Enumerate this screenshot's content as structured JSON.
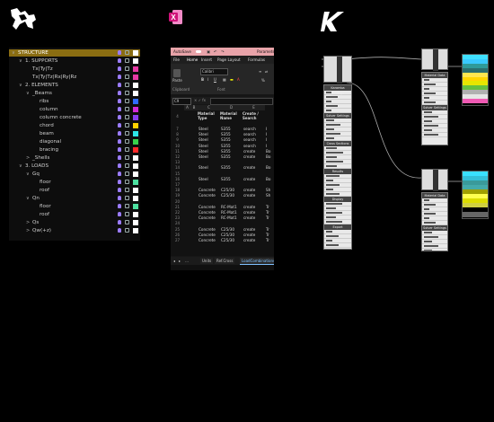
{
  "apps": {
    "rhino_logo": "rhino-icon",
    "excel_logo": "excel-icon",
    "gh_logo": "grasshopper-icon"
  },
  "layers": [
    {
      "label": "STRUCTURE",
      "indent": 0,
      "twisty": "∨",
      "selected": true,
      "color": "#ffffff"
    },
    {
      "label": "1. SUPPORTS",
      "indent": 1,
      "twisty": "∨",
      "color": "#ffffff"
    },
    {
      "label": "Tx|Ty|Tz",
      "indent": 2,
      "twisty": "",
      "color": "#e83aa5"
    },
    {
      "label": "Tx|Ty|Tz|Rx|Ry|Rz",
      "indent": 2,
      "twisty": "",
      "color": "#e83aa5"
    },
    {
      "label": "2. ELEMENTS",
      "indent": 1,
      "twisty": "∨",
      "color": "#ffffff"
    },
    {
      "label": "_Beams",
      "indent": 2,
      "twisty": "∨",
      "color": "#ffffff"
    },
    {
      "label": "ribs",
      "indent": 3,
      "twisty": "",
      "color": "#2f6bff"
    },
    {
      "label": "column",
      "indent": 3,
      "twisty": "",
      "color": "#d22ad6"
    },
    {
      "label": "column concrete",
      "indent": 3,
      "twisty": "",
      "color": "#8a3df0"
    },
    {
      "label": "chord",
      "indent": 3,
      "twisty": "",
      "color": "#ffd200"
    },
    {
      "label": "beam",
      "indent": 3,
      "twisty": "",
      "color": "#2ee6e6"
    },
    {
      "label": "diagonal",
      "indent": 3,
      "twisty": "",
      "color": "#37d14b"
    },
    {
      "label": "bracing",
      "indent": 3,
      "twisty": "",
      "color": "#ff2a2a"
    },
    {
      "label": "_Shells",
      "indent": 2,
      "twisty": ">",
      "color": "#ffffff"
    },
    {
      "label": "3. LOADS",
      "indent": 1,
      "twisty": "∨",
      "color": "#ffffff"
    },
    {
      "label": "Gq",
      "indent": 2,
      "twisty": "∨",
      "color": "#ffffff"
    },
    {
      "label": "floor",
      "indent": 3,
      "twisty": "",
      "color": "#4de0a0"
    },
    {
      "label": "roof",
      "indent": 3,
      "twisty": "",
      "color": "#ffffff"
    },
    {
      "label": "Qn",
      "indent": 2,
      "twisty": "∨",
      "color": "#ffffff"
    },
    {
      "label": "floor",
      "indent": 3,
      "twisty": "",
      "color": "#4de0a0"
    },
    {
      "label": "roof",
      "indent": 3,
      "twisty": "",
      "color": "#ffffff"
    },
    {
      "label": "Qs",
      "indent": 2,
      "twisty": ">",
      "color": "#ffffff"
    },
    {
      "label": "Qw(+z)",
      "indent": 2,
      "twisty": ">",
      "color": "#ffffff"
    }
  ],
  "excel": {
    "title_left": "AutoSave",
    "title_right": "Parameter",
    "menu": [
      "File",
      "Home",
      "Insert",
      "Page Layout",
      "Formulas"
    ],
    "ribbon": {
      "paste": "Paste",
      "clipboard": "Clipboard",
      "font_name": "Calibri",
      "font_label": "Font"
    },
    "name_box": "C9",
    "columns": [
      "A",
      "B",
      "C",
      "D",
      "E"
    ],
    "headers": {
      "c": "Material Type",
      "d": "Material Name",
      "e": "Create / Search"
    },
    "rows": [
      {
        "n": "7",
        "c": "Steel",
        "d": "S355",
        "e": "search",
        "f": "I"
      },
      {
        "n": "8",
        "c": "Steel",
        "d": "S355",
        "e": "search",
        "f": "I"
      },
      {
        "n": "9",
        "c": "Steel",
        "d": "S355",
        "e": "search",
        "f": "I"
      },
      {
        "n": "10",
        "c": "Steel",
        "d": "S355",
        "e": "search",
        "f": "I"
      },
      {
        "n": "11",
        "c": "Steel",
        "d": "S355",
        "e": "create",
        "f": "Bo"
      },
      {
        "n": "12",
        "c": "Steel",
        "d": "S355",
        "e": "create",
        "f": "Bo"
      },
      {
        "n": "13",
        "c": "",
        "d": "",
        "e": "",
        "f": ""
      },
      {
        "n": "14",
        "c": "Steel",
        "d": "S355",
        "e": "create",
        "f": "Bo"
      },
      {
        "n": "15",
        "c": "",
        "d": "",
        "e": "",
        "f": ""
      },
      {
        "n": "16",
        "c": "Steel",
        "d": "S355",
        "e": "create",
        "f": "Bo"
      },
      {
        "n": "17",
        "c": "",
        "d": "",
        "e": "",
        "f": ""
      },
      {
        "n": "18",
        "c": "Concrete",
        "d": "C25/30",
        "e": "create",
        "f": "Sh"
      },
      {
        "n": "19",
        "c": "Concrete",
        "d": "C25/30",
        "e": "create",
        "f": "Sh"
      },
      {
        "n": "20",
        "c": "",
        "d": "",
        "e": "",
        "f": ""
      },
      {
        "n": "21",
        "c": "Concrete",
        "d": "RC-Mat1",
        "e": "create",
        "f": "Tr"
      },
      {
        "n": "22",
        "c": "Concrete",
        "d": "RC-Mat1",
        "e": "create",
        "f": "Tr"
      },
      {
        "n": "23",
        "c": "Concrete",
        "d": "RC-Mat1",
        "e": "create",
        "f": "Tr"
      },
      {
        "n": "24",
        "c": "",
        "d": "",
        "e": "",
        "f": ""
      },
      {
        "n": "25",
        "c": "Concrete",
        "d": "C25/30",
        "e": "create",
        "f": "Tr"
      },
      {
        "n": "26",
        "c": "Concrete",
        "d": "C25/30",
        "e": "create",
        "f": "Tr"
      },
      {
        "n": "27",
        "c": "Concrete",
        "d": "C25/30",
        "e": "create",
        "f": "Tr"
      }
    ],
    "tabs": [
      "Units",
      "Ref.Cross",
      "LoadCombinations"
    ],
    "active_tab": 2
  },
  "gh": {
    "sections_mid": [
      "Karamba Settings",
      "Solver Settings",
      "Cross Sections",
      "Results",
      "Display",
      "Export",
      "Project Data"
    ],
    "sections_right": [
      "Material Data",
      "Solver Settings",
      "Model Data",
      "Summary"
    ],
    "gradient1": [
      "#3fe0ff",
      "#39c9ff",
      "#2f9a9a",
      "#2b6e6e",
      "#ffe650",
      "#ffd500",
      "#e6e600",
      "#66c040",
      "#b0b0b0",
      "#e5e5e5",
      "#f05ab4"
    ],
    "gradient2": [
      "#39e0ff",
      "#33c0d8",
      "#3a9a9a",
      "#4aa",
      "#a0a000",
      "#ffff50",
      "#dddd00",
      "#d0d040",
      "#000000",
      "#666666"
    ]
  }
}
